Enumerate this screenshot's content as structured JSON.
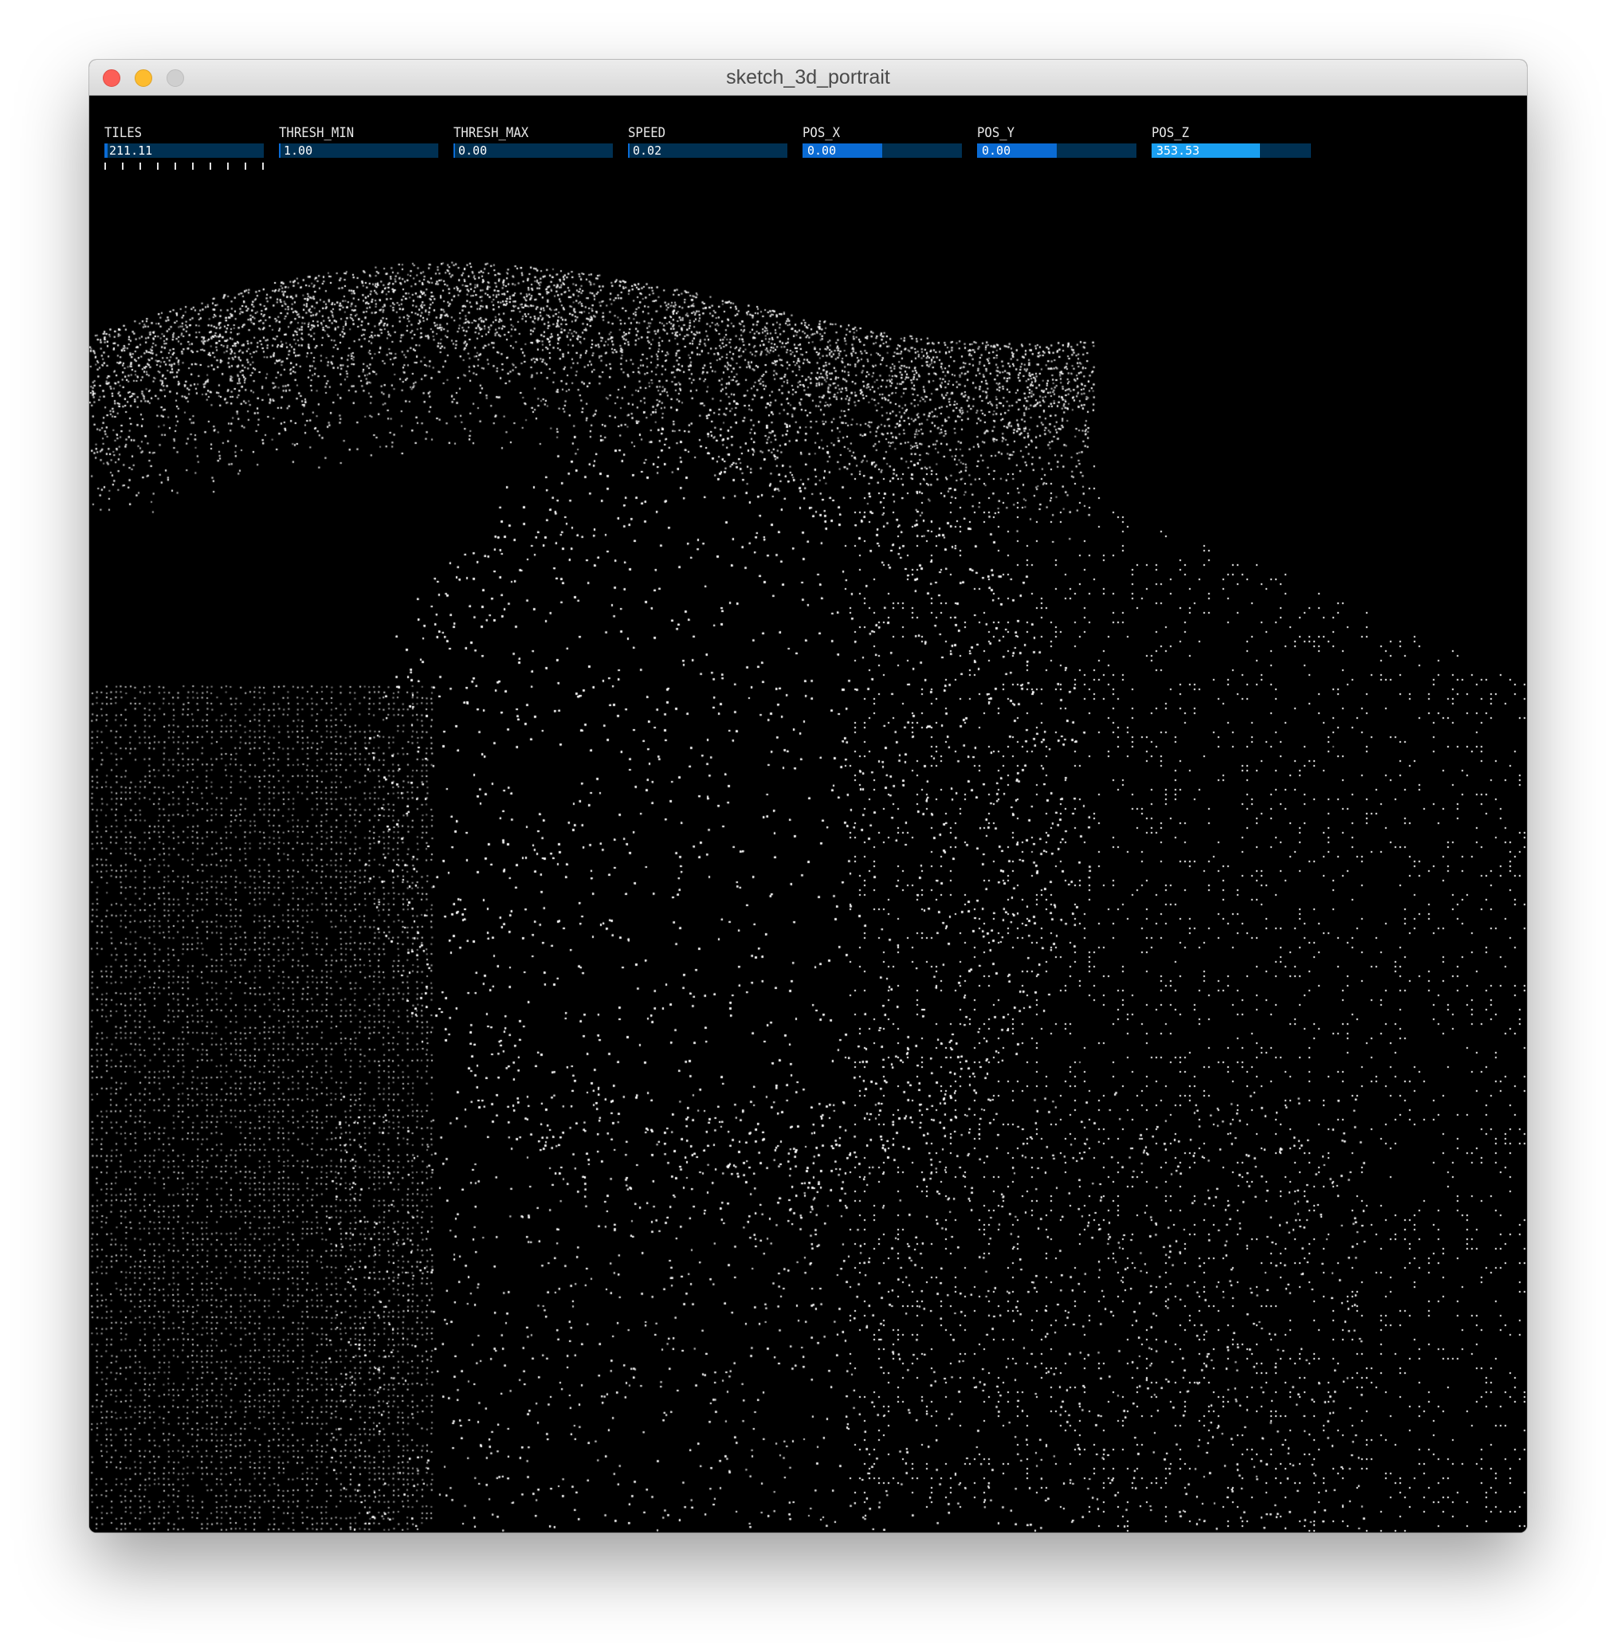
{
  "window": {
    "title": "sketch_3d_portrait"
  },
  "controls": [
    {
      "label": "TILES",
      "value": "211.11",
      "level": 0.02,
      "fill_color": "#0a6bd4"
    },
    {
      "label": "THRESH_MIN",
      "value": "1.00",
      "level": 0.01,
      "fill_color": "#0a6bd4"
    },
    {
      "label": "THRESH_MAX",
      "value": "0.00",
      "level": 0.0,
      "fill_color": "#0a6bd4"
    },
    {
      "label": "SPEED",
      "value": "0.02",
      "level": 0.01,
      "fill_color": "#0a6bd4"
    },
    {
      "label": "POS_X",
      "value": "0.00",
      "level": 0.5,
      "fill_color": "#0a6bd4"
    },
    {
      "label": "POS_Y",
      "value": "0.00",
      "level": 0.5,
      "fill_color": "#0a6bd4"
    },
    {
      "label": "POS_Z",
      "value": "353.53",
      "level": 0.68,
      "fill_color": "#1a9ff0"
    }
  ],
  "colors": {
    "bar_background": "#003052",
    "canvas_background": "#000000",
    "points": "#ffffff"
  },
  "icons": {
    "close": "close-traffic-light-icon",
    "minimize": "minimize-traffic-light-icon",
    "zoom": "zoom-traffic-light-icon"
  }
}
